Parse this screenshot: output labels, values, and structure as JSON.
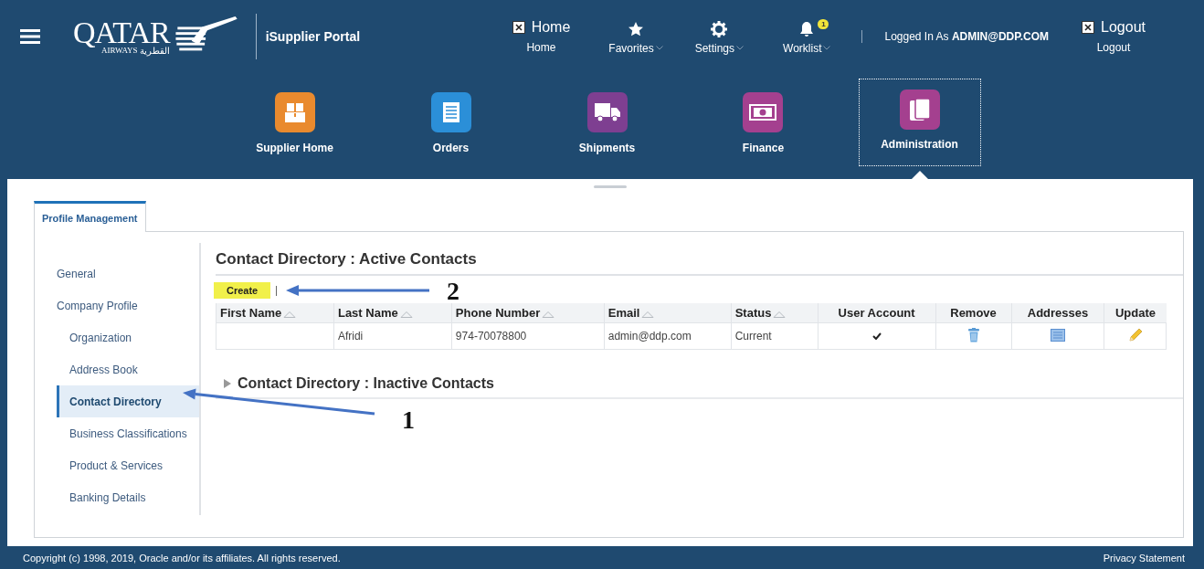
{
  "header": {
    "logo": {
      "name": "QATAR",
      "subtitle": "AIRWAYS",
      "arabic": "القطرية"
    },
    "app_title": "iSupplier Portal",
    "nav": [
      {
        "kind": "box",
        "label": "Home",
        "sublabel": "Home"
      },
      {
        "kind": "menu",
        "label": "Favorites"
      },
      {
        "kind": "menu",
        "label": "Settings"
      },
      {
        "kind": "menu",
        "label": "Worklist",
        "badge": "1"
      }
    ],
    "user": {
      "prefix": "Logged In As",
      "name": "ADMIN@DDP.COM"
    },
    "logout": {
      "kind": "box",
      "label": "Logout",
      "sublabel": "Logout"
    }
  },
  "tiles": [
    {
      "label": "Supplier Home",
      "color": "#e98a2e",
      "selected": false
    },
    {
      "label": "Orders",
      "color": "#2b8fd8",
      "selected": false
    },
    {
      "label": "Shipments",
      "color": "#7e3f91",
      "selected": false
    },
    {
      "label": "Finance",
      "color": "#a4408f",
      "selected": false
    },
    {
      "label": "Administration",
      "color": "#a4408f",
      "selected": true
    }
  ],
  "tabs": [
    {
      "label": "Profile Management",
      "selected": true
    }
  ],
  "sidebar": {
    "items": [
      {
        "label": "General",
        "selected": false
      },
      {
        "label": "Company Profile",
        "selected": false,
        "children": [
          {
            "label": "Organization",
            "selected": false
          },
          {
            "label": "Address Book",
            "selected": false
          },
          {
            "label": "Contact Directory",
            "selected": true
          },
          {
            "label": "Business Classifications",
            "selected": false
          },
          {
            "label": "Product & Services",
            "selected": false
          },
          {
            "label": "Banking Details",
            "selected": false
          }
        ]
      }
    ]
  },
  "active_contacts": {
    "title": "Contact Directory : Active Contacts",
    "create_button": "Create",
    "columns": [
      {
        "label": "First Name",
        "sortable": true
      },
      {
        "label": "Last Name",
        "sortable": true
      },
      {
        "label": "Phone Number",
        "sortable": true
      },
      {
        "label": "Email",
        "sortable": true
      },
      {
        "label": "Status",
        "sortable": true
      },
      {
        "label": "User Account",
        "sortable": false
      },
      {
        "label": "Remove",
        "sortable": false
      },
      {
        "label": "Addresses",
        "sortable": false
      },
      {
        "label": "Update",
        "sortable": false
      }
    ],
    "rows": [
      {
        "first_name": "",
        "last_name": "Afridi",
        "phone": "974-70078800",
        "email": "admin@ddp.com",
        "status": "Current",
        "user_account": true
      }
    ]
  },
  "inactive_contacts": {
    "title": "Contact Directory : Inactive Contacts",
    "expanded": false
  },
  "annotations": [
    {
      "label": "1"
    },
    {
      "label": "2"
    }
  ],
  "footer": {
    "copyright": "Copyright (c) 1998, 2019, Oracle and/or its affiliates. All rights reserved.",
    "privacy_link": "Privacy Statement"
  }
}
